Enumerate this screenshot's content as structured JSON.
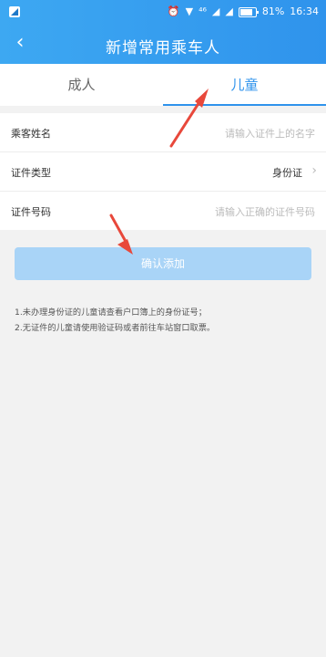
{
  "status_bar": {
    "signal": "⁴⁶",
    "battery_percent": "81%",
    "time": "16:34"
  },
  "header": {
    "title": "新增常用乘车人"
  },
  "tabs": [
    {
      "label": "成人",
      "active": false
    },
    {
      "label": "儿童",
      "active": true
    }
  ],
  "form": {
    "name": {
      "label": "乘客姓名",
      "placeholder": "请输入证件上的名字"
    },
    "id_type": {
      "label": "证件类型",
      "value": "身份证"
    },
    "id_number": {
      "label": "证件号码",
      "placeholder": "请输入正确的证件号码"
    }
  },
  "confirm_button": {
    "label": "确认添加"
  },
  "notes": [
    "1.未办理身份证的儿童请查看户口簿上的身份证号；",
    "2.无证件的儿童请使用验证码或者前往车站窗口取票。"
  ],
  "colors": {
    "primary": "#2f93ec",
    "button": "#a9d4f7",
    "arrow": "#e8483b"
  }
}
